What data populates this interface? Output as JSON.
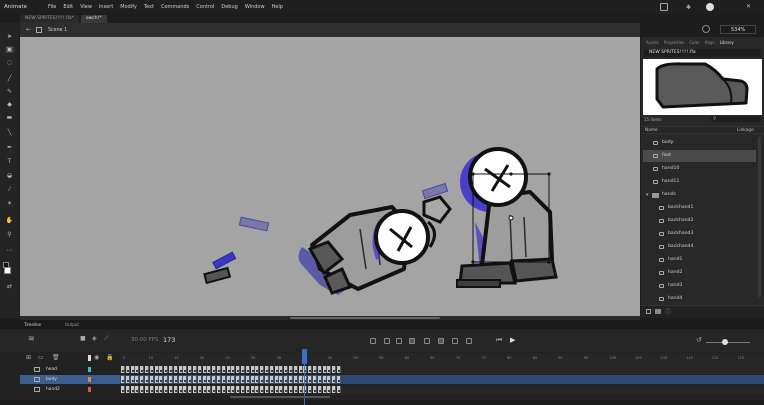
{
  "app": {
    "name": "Animate"
  },
  "menu": [
    "File",
    "Edit",
    "View",
    "Insert",
    "Modify",
    "Text",
    "Commands",
    "Control",
    "Debug",
    "Window",
    "Help"
  ],
  "top_right": {
    "zoom": "534%"
  },
  "document_tabs": [
    {
      "label": "NEW SPRITES!!!!!.fla*",
      "active": false
    },
    {
      "label": "owch!*",
      "active": true
    }
  ],
  "scene": {
    "label": "Scene 1"
  },
  "right_panel": {
    "tabs": [
      {
        "label": "Assets",
        "active": false
      },
      {
        "label": "Properties",
        "active": false
      },
      {
        "label": "Color",
        "active": false
      },
      {
        "label": "Align",
        "active": false
      },
      {
        "label": "Library",
        "active": true
      }
    ],
    "library_selector": "NEW SPRITES!!!!!.fla",
    "item_count": "15 items",
    "columns": {
      "name": "Name",
      "linkage": "Linkage"
    },
    "items": [
      {
        "label": "body",
        "selected": false,
        "folder": false,
        "indent": false
      },
      {
        "label": "foot",
        "selected": true,
        "folder": false,
        "indent": false
      },
      {
        "label": "hand10",
        "selected": false,
        "folder": false,
        "indent": false
      },
      {
        "label": "hand11",
        "selected": false,
        "folder": false,
        "indent": false
      },
      {
        "label": "hands",
        "selected": false,
        "folder": true,
        "indent": false
      },
      {
        "label": "backhand1",
        "selected": false,
        "folder": false,
        "indent": true
      },
      {
        "label": "backhand2",
        "selected": false,
        "folder": false,
        "indent": true
      },
      {
        "label": "backhand3",
        "selected": false,
        "folder": false,
        "indent": true
      },
      {
        "label": "backhand4",
        "selected": false,
        "folder": false,
        "indent": true
      },
      {
        "label": "hand1",
        "selected": false,
        "folder": false,
        "indent": true
      },
      {
        "label": "hand2",
        "selected": false,
        "folder": false,
        "indent": true
      },
      {
        "label": "hand3",
        "selected": false,
        "folder": false,
        "indent": true
      },
      {
        "label": "hand4",
        "selected": false,
        "folder": false,
        "indent": true
      }
    ]
  },
  "timeline": {
    "tabs": [
      {
        "label": "Timeline",
        "active": true
      },
      {
        "label": "Output",
        "active": false
      }
    ],
    "fps": "30.00 FPS",
    "current_frame": "173",
    "frame_ticks": [
      "5",
      "10",
      "15",
      "20",
      "25",
      "30",
      "35",
      "40",
      "45",
      "50",
      "55",
      "60",
      "65",
      "70",
      "75",
      "80",
      "85",
      "90",
      "95",
      "100",
      "105",
      "110",
      "115",
      "120",
      "125"
    ],
    "second_markers": [
      "1s",
      "2s",
      "3s",
      "4s",
      "5s"
    ],
    "layers": [
      {
        "name": "head",
        "color": "#2fc6d6",
        "selected": false
      },
      {
        "name": "body",
        "color": "#e08a2e",
        "selected": true
      },
      {
        "name": "hand2",
        "color": "#e05a3a",
        "selected": false
      }
    ],
    "keyframe_count": 46
  },
  "colors": {
    "stage_bg": "#a4a4a4",
    "selection_blue": "#3a2fd0",
    "outline": "#111111",
    "playhead": "#3b6ec8"
  }
}
